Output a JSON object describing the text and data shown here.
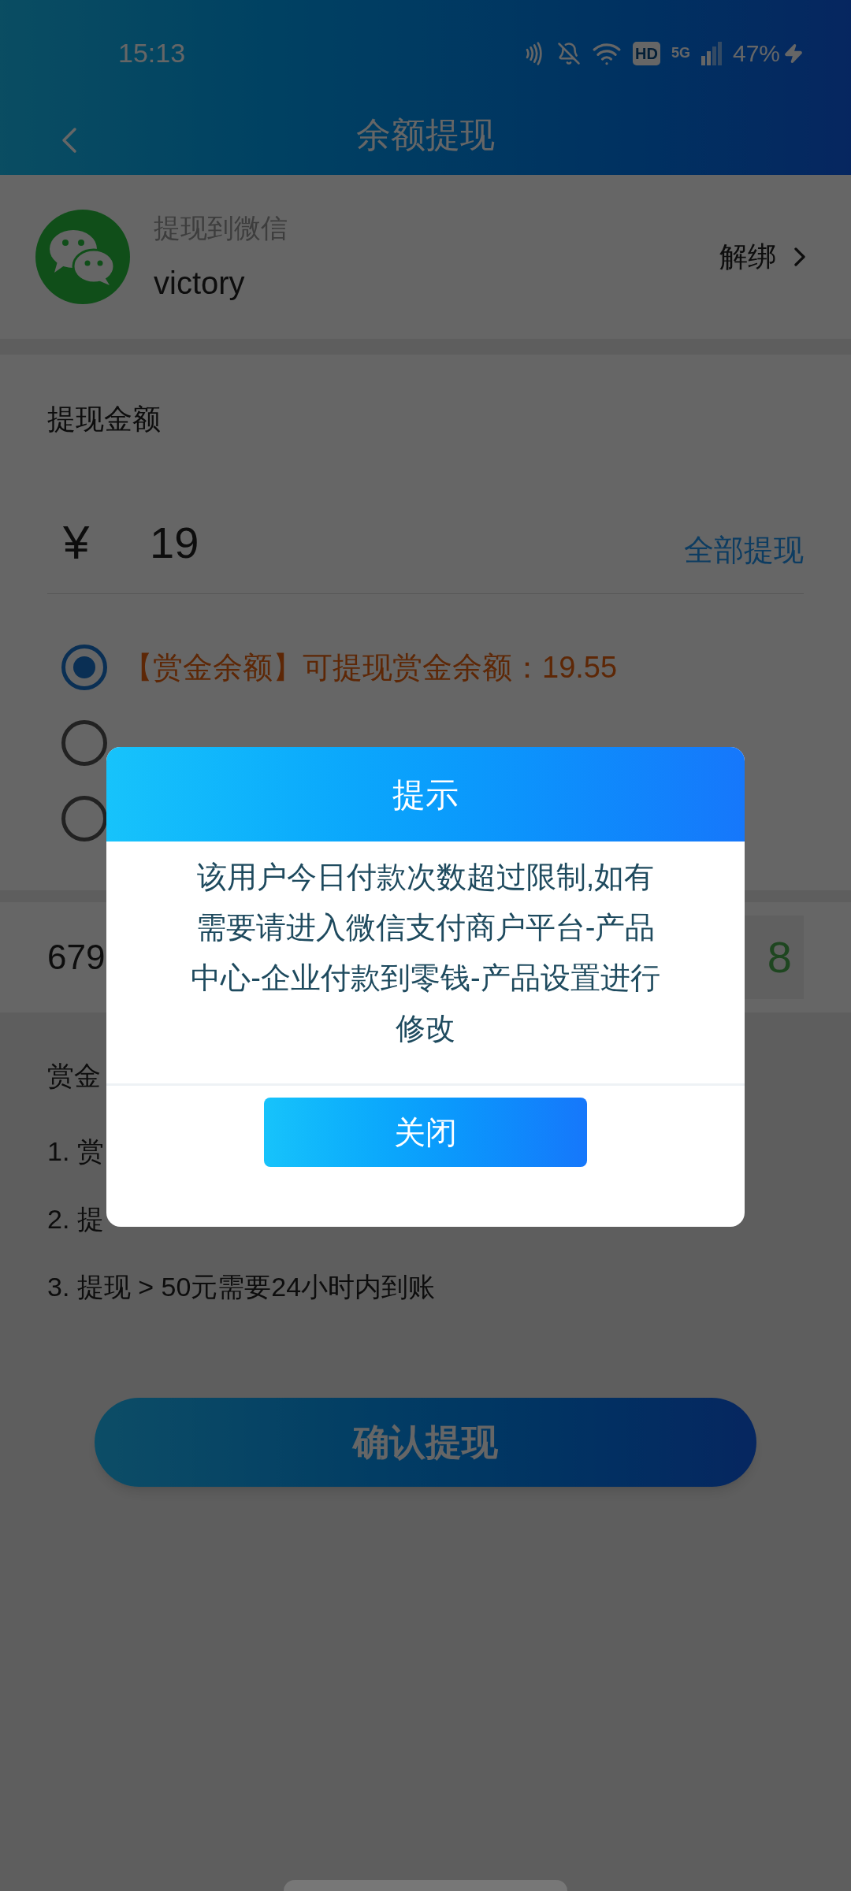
{
  "status_bar": {
    "time": "15:13",
    "hd": "HD",
    "network": "5G",
    "battery": "47%"
  },
  "header": {
    "title": "余额提现"
  },
  "account": {
    "label": "提现到微信",
    "name": "victory",
    "action": "解绑"
  },
  "amount": {
    "label": "提现金额",
    "currency": "¥",
    "value": "19",
    "all_button": "全部提现"
  },
  "balance_options": [
    {
      "text": "【赏金余额】可提现赏金余额：19.55",
      "selected": true
    },
    {
      "selected": false
    },
    {
      "selected": false
    }
  ],
  "account_row": {
    "text": "679",
    "code": "8"
  },
  "notes": {
    "title": "赏金",
    "items": [
      "1. 赏",
      "2. 提",
      "3. 提现 > 50元需要24小时内到账"
    ]
  },
  "confirm_button": "确认提现",
  "dialog": {
    "title": "提示",
    "message": "该用户今日付款次数超过限制,如有需要请进入微信支付商户平台-产品中心-企业付款到零钱-产品设置进行修改",
    "button": "关闭"
  }
}
